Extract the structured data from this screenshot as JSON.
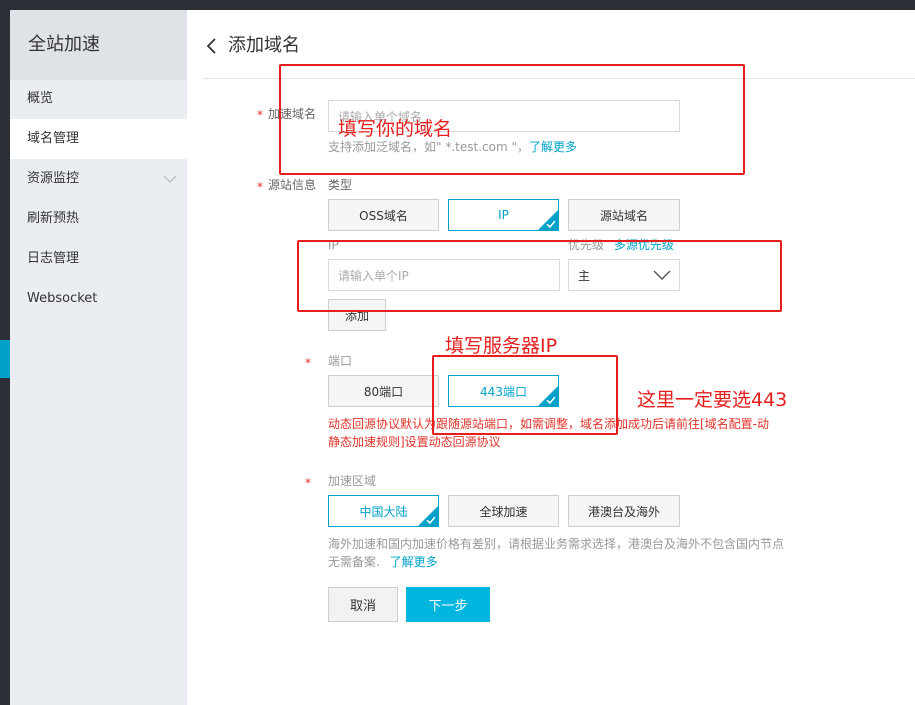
{
  "sidebar": {
    "title": "全站加速",
    "items": [
      {
        "label": "概览"
      },
      {
        "label": "域名管理"
      },
      {
        "label": "资源监控"
      },
      {
        "label": "刷新预热"
      },
      {
        "label": "日志管理"
      },
      {
        "label": "Websocket"
      }
    ]
  },
  "header": {
    "title": "添加域名"
  },
  "form": {
    "domain": {
      "label": "加速域名",
      "placeholder": "请输入单个域名",
      "help_prefix": "支持添加泛域名，如\" *.test.com \"，",
      "help_link": "了解更多"
    },
    "origin": {
      "label": "源站信息",
      "type_label": "类型",
      "types": [
        {
          "label": "OSS域名"
        },
        {
          "label": "IP"
        },
        {
          "label": "源站域名"
        }
      ],
      "ip_label": "IP",
      "priority_label": "优先级",
      "priority_link": "多源优先级",
      "ip_placeholder": "请输入单个IP",
      "priority_value": "主",
      "add_button": "添加"
    },
    "port": {
      "label": "端口",
      "options": [
        {
          "label": "80端口"
        },
        {
          "label": "443端口"
        }
      ],
      "warning": "动态回源协议默认为跟随源站端口，如需调整，域名添加成功后请前往[域名配置-动静态加速规则]设置动态回源协议",
      "warning_line1": "动态回源协议默认为跟随源站端口，如需调整，域名添加成功后请前往[域名配置-动",
      "warning_line2": "静态加速规则]设置动态回源协议"
    },
    "region": {
      "label": "加速区域",
      "options": [
        {
          "label": "中国大陆"
        },
        {
          "label": "全球加速"
        },
        {
          "label": "港澳台及海外"
        }
      ],
      "help_line1": "海外加速和国内加速价格有差别，请根据业务需求选择，港澳台及海外不包含国内节点",
      "help_line2_prefix": "无需备案.",
      "help_link": "了解更多"
    },
    "actions": {
      "cancel": "取消",
      "next": "下一步"
    }
  },
  "annotations": {
    "domain_note": "填写你的域名",
    "ip_note": "填写服务器IP",
    "port_note": "这里一定要选443"
  },
  "colors": {
    "accent": "#00a2ca",
    "primary_button": "#00b5de",
    "required": "#e0332a",
    "annotation": "#e81e1e",
    "sidebar_bg": "#eaedf1"
  }
}
